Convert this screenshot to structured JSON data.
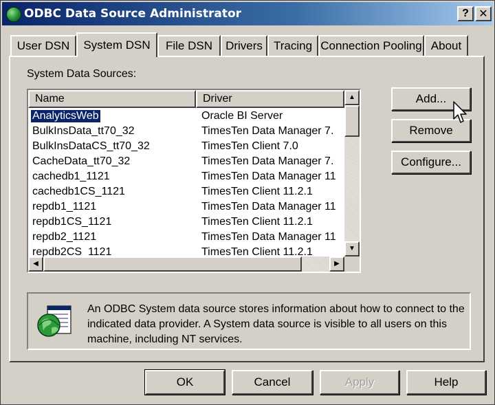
{
  "window": {
    "title": "ODBC Data Source Administrator",
    "help_glyph": "?",
    "close_glyph": "✕"
  },
  "tabs": [
    {
      "label": "User DSN",
      "active": false
    },
    {
      "label": "System DSN",
      "active": true
    },
    {
      "label": "File DSN",
      "active": false
    },
    {
      "label": "Drivers",
      "active": false
    },
    {
      "label": "Tracing",
      "active": false
    },
    {
      "label": "Connection Pooling",
      "active": false
    },
    {
      "label": "About",
      "active": false
    }
  ],
  "system_dsn": {
    "section_label": "System Data Sources:",
    "columns": {
      "name": "Name",
      "driver": "Driver"
    },
    "rows": [
      {
        "name": "AnalyticsWeb",
        "driver": "Oracle BI Server",
        "selected": true
      },
      {
        "name": "BulkInsData_tt70_32",
        "driver": "TimesTen Data Manager 7."
      },
      {
        "name": "BulkInsDataCS_tt70_32",
        "driver": "TimesTen Client 7.0"
      },
      {
        "name": "CacheData_tt70_32",
        "driver": "TimesTen Data Manager 7."
      },
      {
        "name": "cachedb1_1121",
        "driver": "TimesTen Data Manager 11"
      },
      {
        "name": "cachedb1CS_1121",
        "driver": "TimesTen Client 11.2.1"
      },
      {
        "name": "repdb1_1121",
        "driver": "TimesTen Data Manager 11"
      },
      {
        "name": "repdb1CS_1121",
        "driver": "TimesTen Client 11.2.1"
      },
      {
        "name": "repdb2_1121",
        "driver": "TimesTen Data Manager 11"
      },
      {
        "name": "repdb2CS_1121",
        "driver": "TimesTen Client 11.2.1"
      }
    ],
    "buttons": {
      "add": "Add...",
      "remove": "Remove",
      "configure": "Configure..."
    },
    "info_text": "An ODBC System data source stores information about how to connect to the indicated data provider.  A System data source is visible to all users on this machine, including NT services."
  },
  "footer": {
    "ok": "OK",
    "cancel": "Cancel",
    "apply": "Apply",
    "help": "Help"
  },
  "colors": {
    "title_start": "#0a246a",
    "title_end": "#a6caf0",
    "face": "#d4d0c8",
    "selection": "#0a246a"
  }
}
